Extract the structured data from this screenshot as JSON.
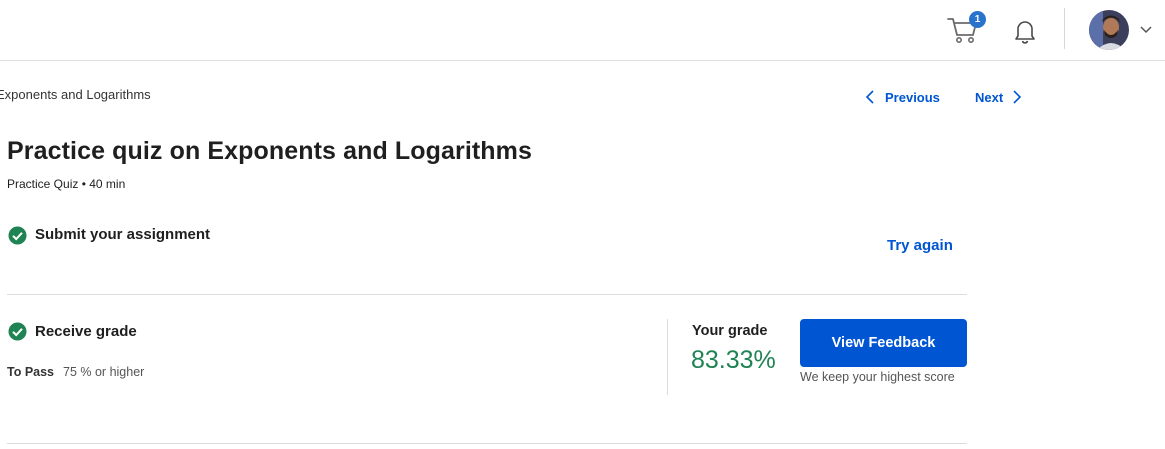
{
  "header": {
    "cart_count": "1",
    "icons": [
      "cart-icon",
      "bell-icon",
      "avatar",
      "chevron-down-icon"
    ]
  },
  "breadcrumb": "Exponents and Logarithms",
  "nav": {
    "previous_label": "Previous",
    "next_label": "Next"
  },
  "quiz": {
    "title": "Practice quiz on Exponents and Logarithms",
    "meta": "Practice Quiz • 40 min"
  },
  "submit_section": {
    "label": "Submit your assignment",
    "action_label": "Try again"
  },
  "grade_section": {
    "label": "Receive grade",
    "to_pass_label": "To Pass",
    "to_pass_value": "75 % or higher",
    "your_grade_label": "Your grade",
    "grade_value": "83.33%",
    "feedback_button_label": "View Feedback",
    "keep_note": "We keep your highest score"
  },
  "colors": {
    "accent": "#0056d2",
    "success": "#1f8354",
    "badge": "#2a73cc"
  }
}
